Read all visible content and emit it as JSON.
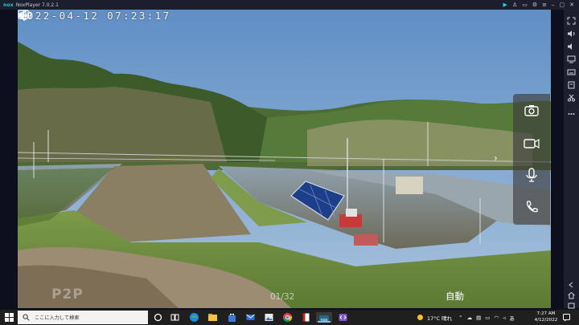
{
  "titlebar": {
    "logo": "nox",
    "app_name": "NoxPlayer 7.0.2.1"
  },
  "camera": {
    "timestamp": "2022-04-12 07:23:17",
    "watermark": "P2P",
    "page_counter": "01/32",
    "auto_label": "自動"
  },
  "icons": {
    "back": "back-arrow-icon",
    "snapshot": "camera-icon",
    "record": "video-camera-icon",
    "talk": "microphone-icon",
    "call": "phone-icon",
    "speaker": "speaker-icon",
    "layout": "grid-layout-icon"
  },
  "taskbar": {
    "search_placeholder": "ここに入力して検索",
    "weather": "17°C 晴れ",
    "time": "7:27 AM",
    "date": "4/12/2022"
  },
  "colors": {
    "sky": "#6f9bcc",
    "nox_accent": "#2fc4e8",
    "taskbar": "#1f1f1f"
  }
}
